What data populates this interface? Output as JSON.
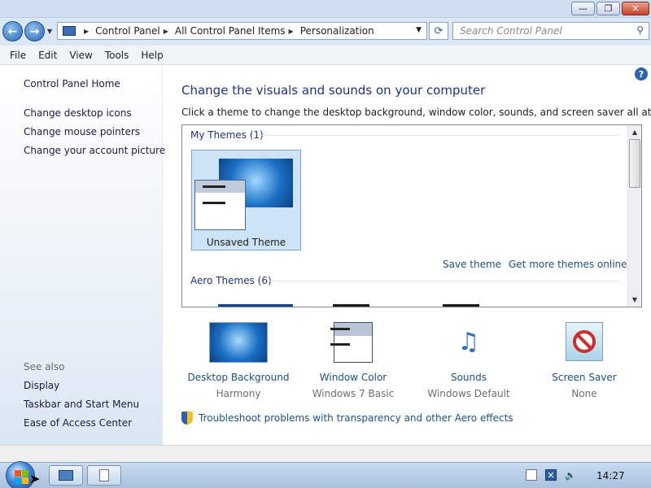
{
  "window": {
    "minimize_glyph": "—",
    "maximize_glyph": "❐",
    "close_glyph": "✕"
  },
  "address": {
    "back_glyph": "←",
    "forward_glyph": "→",
    "crumbs": [
      "Control Panel",
      "All Control Panel Items",
      "Personalization"
    ],
    "refresh_glyph": "⟳",
    "search_placeholder": "Search Control Panel"
  },
  "menu": [
    "File",
    "Edit",
    "View",
    "Tools",
    "Help"
  ],
  "left_pane": {
    "home_link": "Control Panel Home",
    "tasks": [
      "Change desktop icons",
      "Change mouse pointers",
      "Change your account picture"
    ],
    "see_also_label": "See also",
    "see_also": [
      "Display",
      "Taskbar and Start Menu",
      "Ease of Access Center"
    ]
  },
  "main": {
    "heading": "Change the visuals and sounds on your computer",
    "description": "Click a theme to change the desktop background, window color, sounds, and screen saver all at once.",
    "help_glyph": "?"
  },
  "theme_panel": {
    "my_themes_header": "My Themes (1)",
    "selected_theme": "Unsaved Theme",
    "save_theme": "Save theme",
    "get_more": "Get more themes online",
    "aero_themes_header": "Aero Themes (6)"
  },
  "options": [
    {
      "title": "Desktop Background",
      "value": "Harmony",
      "icon": "desktop-background-icon"
    },
    {
      "title": "Window Color",
      "value": "Windows 7 Basic",
      "icon": "window-color-icon"
    },
    {
      "title": "Sounds",
      "value": "Windows Default",
      "icon": "sounds-icon"
    },
    {
      "title": "Screen Saver",
      "value": "None",
      "icon": "screen-saver-icon"
    }
  ],
  "troubleshoot": "Troubleshoot problems with transparency and other Aero effects",
  "taskbar": {
    "clock": "14:27"
  },
  "colors": {
    "link": "#1c5180",
    "heading": "#1e3287",
    "taskbar": "#a8c1de"
  }
}
